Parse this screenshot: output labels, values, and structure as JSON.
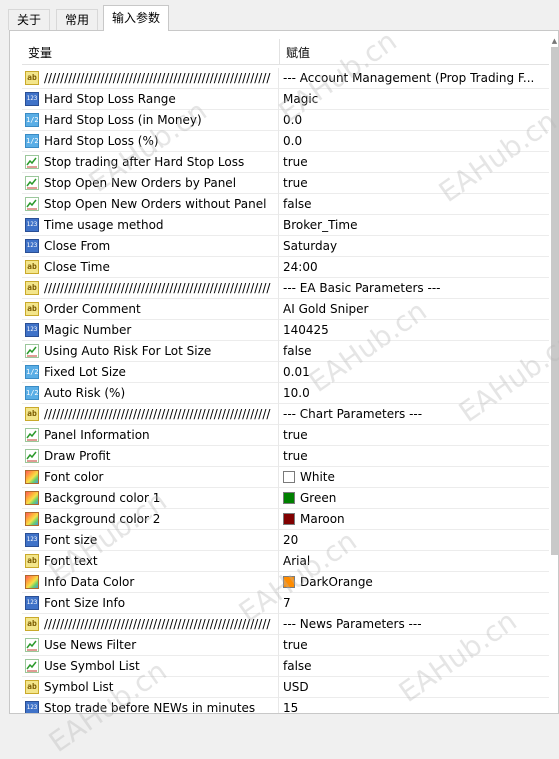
{
  "tabs": [
    {
      "label": "关于"
    },
    {
      "label": "常用"
    },
    {
      "label": "输入参数"
    }
  ],
  "grid": {
    "header": {
      "variable": "变量",
      "value": "赋值"
    },
    "rows": [
      {
        "icon": "string-icon",
        "name": "////////////////////////////////////////////////////////",
        "value": "--- Account Management (Prop Trading F..."
      },
      {
        "icon": "integer-icon",
        "name": "Hard Stop Loss Range",
        "value": "Magic"
      },
      {
        "icon": "double-icon",
        "name": "Hard Stop Loss (in Money)",
        "value": "0.0"
      },
      {
        "icon": "double-icon",
        "name": "Hard Stop Loss (%)",
        "value": "0.0"
      },
      {
        "icon": "bool-icon",
        "name": "Stop trading after Hard Stop Loss",
        "value": "true"
      },
      {
        "icon": "bool-icon",
        "name": "Stop Open New Orders by Panel",
        "value": "true"
      },
      {
        "icon": "bool-icon",
        "name": "Stop Open New Orders without Panel",
        "value": "false"
      },
      {
        "icon": "integer-icon",
        "name": "Time usage method",
        "value": "Broker_Time"
      },
      {
        "icon": "integer-icon",
        "name": "Close From",
        "value": "Saturday"
      },
      {
        "icon": "string-icon",
        "name": "Close Time",
        "value": "24:00"
      },
      {
        "icon": "string-icon",
        "name": "////////////////////////////////////////////////////////",
        "value": "--- EA Basic Parameters ---"
      },
      {
        "icon": "string-icon",
        "name": "Order Comment",
        "value": "AI Gold Sniper"
      },
      {
        "icon": "integer-icon",
        "name": "Magic Number",
        "value": "140425"
      },
      {
        "icon": "bool-icon",
        "name": "Using Auto Risk For Lot Size",
        "value": "false"
      },
      {
        "icon": "double-icon",
        "name": "Fixed Lot Size",
        "value": "0.01"
      },
      {
        "icon": "double-icon",
        "name": "Auto Risk (%)",
        "value": "10.0"
      },
      {
        "icon": "string-icon",
        "name": "////////////////////////////////////////////////////////",
        "value": "--- Chart Parameters ---"
      },
      {
        "icon": "bool-icon",
        "name": "Panel Information",
        "value": "true"
      },
      {
        "icon": "bool-icon",
        "name": "Draw Profit",
        "value": "true"
      },
      {
        "icon": "color-icon",
        "name": "Font color",
        "value": "White",
        "swatch": "#ffffff"
      },
      {
        "icon": "color-icon",
        "name": "Background color 1",
        "value": "Green",
        "swatch": "#008000"
      },
      {
        "icon": "color-icon",
        "name": "Background color 2",
        "value": "Maroon",
        "swatch": "#800000"
      },
      {
        "icon": "integer-icon",
        "name": "Font size",
        "value": "20"
      },
      {
        "icon": "string-icon",
        "name": "Font text",
        "value": "Arial"
      },
      {
        "icon": "color-icon",
        "name": "Info Data Color",
        "value": "DarkOrange",
        "swatch": "#ff8c00"
      },
      {
        "icon": "integer-icon",
        "name": "Font Size Info",
        "value": "7"
      },
      {
        "icon": "string-icon",
        "name": "////////////////////////////////////////////////////////",
        "value": "--- News Parameters ---"
      },
      {
        "icon": "bool-icon",
        "name": "Use News Filter",
        "value": "true"
      },
      {
        "icon": "bool-icon",
        "name": "Use Symbol List",
        "value": "false"
      },
      {
        "icon": "string-icon",
        "name": "Symbol List",
        "value": "USD"
      },
      {
        "icon": "integer-icon",
        "name": "Stop trade before NEWs in minutes",
        "value": "15"
      }
    ]
  },
  "icon_glyphs": {
    "string": "ab",
    "integer": "123",
    "double": "1/2"
  },
  "watermark": "EAHub.cn"
}
